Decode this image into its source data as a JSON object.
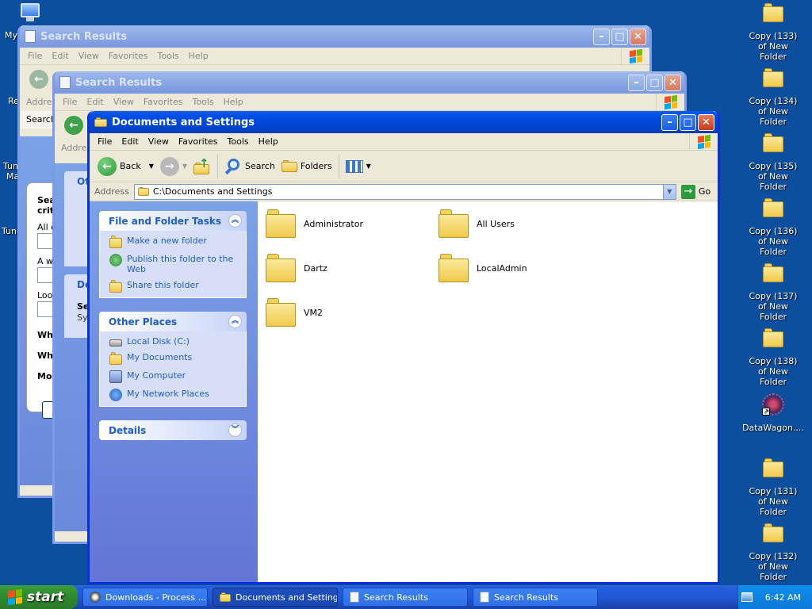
{
  "desktop": {
    "left_partial": [
      "My",
      "Re",
      "Tun",
      "Ma",
      "Tune"
    ],
    "right_icons": [
      {
        "label": "Copy (133) of New Folder"
      },
      {
        "label": "Copy (134) of New Folder"
      },
      {
        "label": "Copy (135) of New Folder"
      },
      {
        "label": "Copy (136) of New Folder"
      },
      {
        "label": "Copy (137) of New Folder"
      },
      {
        "label": "Copy (138) of New Folder"
      },
      {
        "label": "DataWagon...."
      },
      {
        "label": "Copy (131) of New Folder"
      },
      {
        "label": "Copy (132) of New Folder"
      }
    ]
  },
  "search1": {
    "title": "Search Results",
    "menu": [
      "File",
      "Edit",
      "View",
      "Favorites",
      "Tools",
      "Help"
    ],
    "address_label": "Address",
    "search_label": "Search",
    "pane_texts": [
      "Sea",
      "crit",
      "All o",
      "A wo",
      "Look",
      "Whe",
      "Wha",
      "Mor"
    ]
  },
  "search2": {
    "title": "Search Results",
    "menu": [
      "File",
      "Edit",
      "View",
      "Favorites",
      "Tools",
      "Help"
    ],
    "address_label": "Addres",
    "pane_texts": [
      "Oth",
      "De",
      "Se",
      "Sys"
    ]
  },
  "main": {
    "title": "Documents and Settings",
    "menu": [
      "File",
      "Edit",
      "View",
      "Favorites",
      "Tools",
      "Help"
    ],
    "toolbar": {
      "back": "Back",
      "search": "Search",
      "folders": "Folders"
    },
    "address_label": "Address",
    "address_value": "C:\\Documents and Settings",
    "go_label": "Go",
    "tasks": {
      "file_folder": {
        "title": "File and Folder Tasks",
        "items": [
          "Make a new folder",
          "Publish this folder to the Web",
          "Share this folder"
        ]
      },
      "other_places": {
        "title": "Other Places",
        "items": [
          "Local Disk (C:)",
          "My Documents",
          "My Computer",
          "My Network Places"
        ]
      },
      "details": {
        "title": "Details"
      }
    },
    "folders": [
      "Administrator",
      "All Users",
      "Dartz",
      "LocalAdmin",
      "VM2"
    ]
  },
  "taskbar": {
    "start": "start",
    "tasks": [
      "Downloads - Process ...",
      "Documents and Settings",
      "Search Results",
      "Search Results"
    ],
    "clock": "6:42 AM"
  },
  "colors": {
    "accent": "#0831d9",
    "desktop": "#0c4f9f",
    "link": "#215dc6"
  }
}
